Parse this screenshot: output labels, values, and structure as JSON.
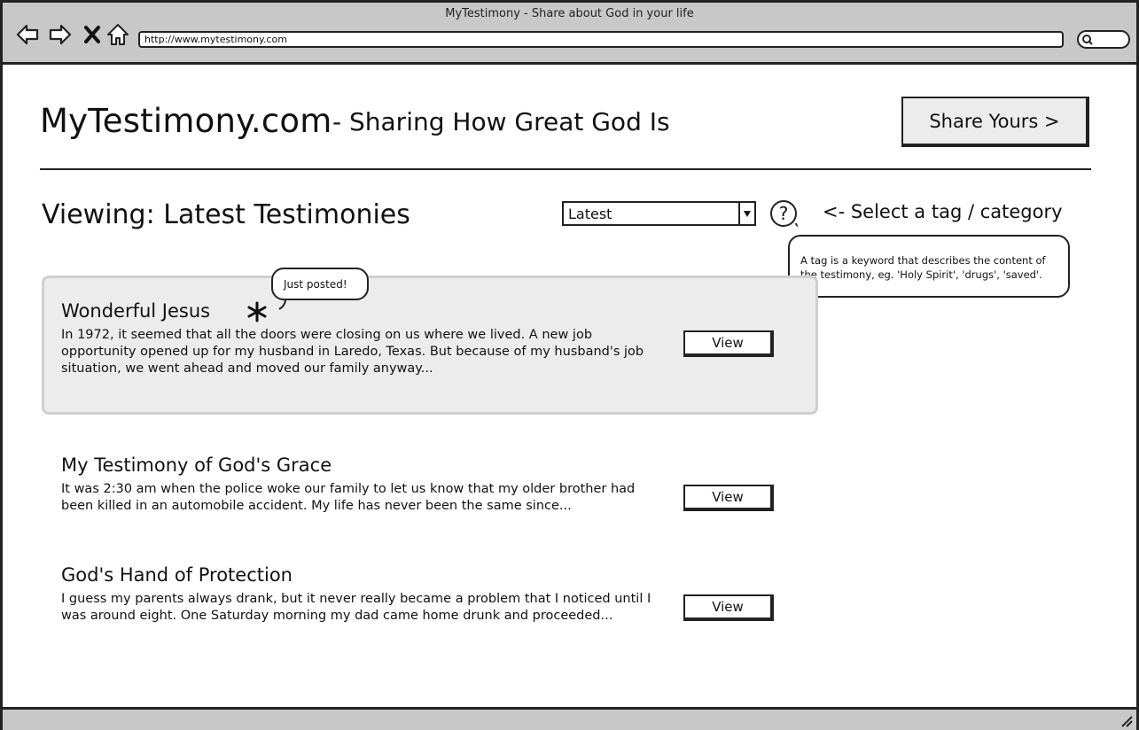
{
  "browser": {
    "window_title": "MyTestimony - Share about God in your life",
    "url": "http://www.mytestimony.com",
    "icons": [
      "back-arrow-icon",
      "forward-arrow-icon",
      "close-icon",
      "home-icon",
      "search-icon"
    ]
  },
  "header": {
    "site_title": "MyTestimony.com",
    "tagline": "- Sharing How Great God Is",
    "share_button": "Share Yours >"
  },
  "filter": {
    "heading": "Viewing: Latest Testimonies",
    "selected_tag": "Latest",
    "help_label": "?",
    "hint": "<-  Select a tag / category",
    "tooltip": "A tag is a keyword that describes the content of the testimony, eg. 'Holy Spirit', 'drugs', 'saved'."
  },
  "testimonies": [
    {
      "title": "Wonderful Jesus",
      "badge": "Just posted!",
      "excerpt": " In 1972, it seemed that all the doors were closing on us where we lived. A new job opportunity opened up for my husband in Laredo, Texas. But because of my husband's job situation, we went ahead and moved our family anyway...",
      "view_label": "View"
    },
    {
      "title": "My Testimony of God's Grace",
      "excerpt": "It was 2:30 am when the police woke our family to let us know that my older brother had been killed in an automobile accident. My life has never been the same since...",
      "view_label": "View"
    },
    {
      "title": "God's Hand of Protection",
      "excerpt": "I guess my parents always drank, but it never really became a problem that I noticed until I was around eight. One Saturday morning my dad came home drunk and proceeded...",
      "view_label": "View"
    }
  ]
}
